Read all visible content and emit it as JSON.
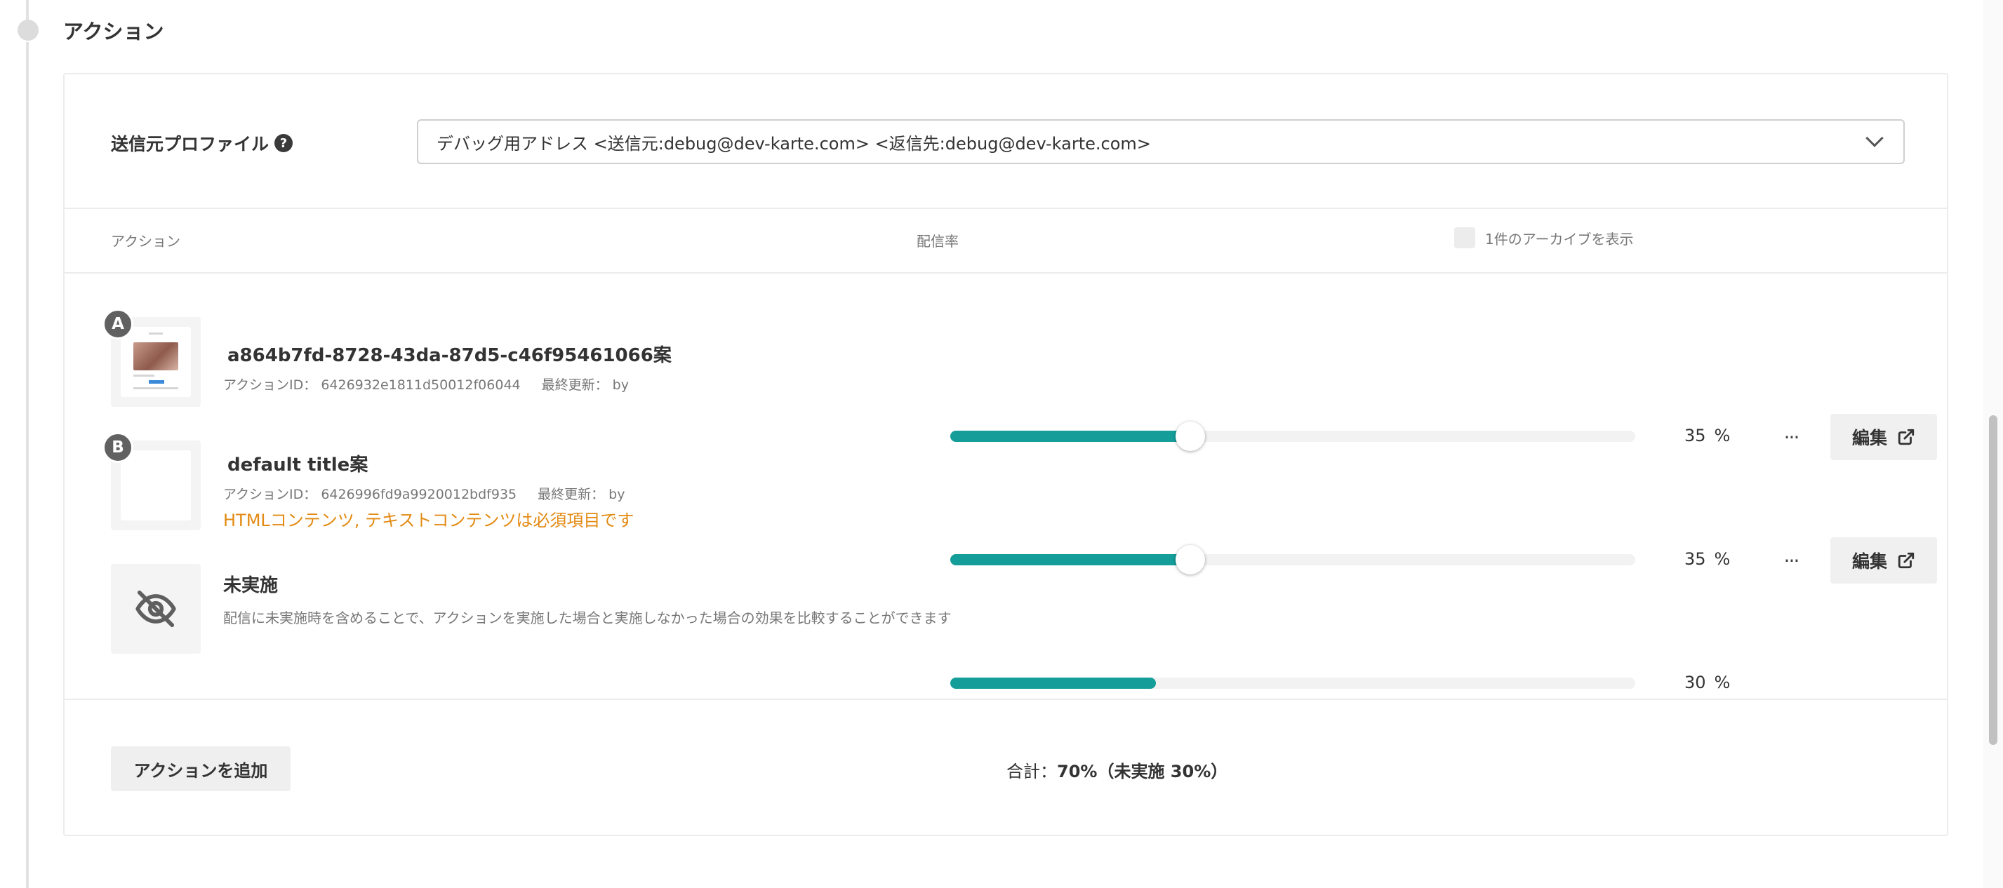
{
  "section": {
    "title": "アクション"
  },
  "profile": {
    "label": "送信元プロファイル",
    "help_icon": "?",
    "selected": "デバッグ用アドレス <送信元:debug@dev-karte.com> <返信先:debug@dev-karte.com>"
  },
  "table": {
    "col_action": "アクション",
    "col_rate": "配信率",
    "archive_label": "1件のアーカイブを表示"
  },
  "rows": [
    {
      "badge": "A",
      "title": "a864b7fd-8728-43da-87d5-c46f95461066案",
      "meta_id": "アクションID： 6426932e1811d50012f06044",
      "meta_updated": "最終更新： by",
      "rate": 35,
      "rate_text": "35",
      "unit": "%",
      "more": "···",
      "edit_label": "編集"
    },
    {
      "badge": "B",
      "title": "default title案",
      "meta_id": "アクションID： 6426996fd9a9920012bdf935",
      "meta_updated": "最終更新： by",
      "error": "HTMLコンテンツ, テキストコンテンツは必須項目です",
      "rate": 35,
      "rate_text": "35",
      "unit": "%",
      "more": "···",
      "edit_label": "編集"
    },
    {
      "title": "未実施",
      "description": "配信に未実施時を含めることで、アクションを実施した場合と実施しなかった場合の効果を比較することができます",
      "rate": 30,
      "rate_text": "30",
      "unit": "%"
    }
  ],
  "footer": {
    "add_button": "アクションを追加",
    "total_prefix": "合計：",
    "total_value": "70%（未実施 30%）"
  },
  "colors": {
    "accent": "#149d99",
    "error": "#e38a12",
    "badge": "#616161"
  },
  "icons": {
    "help": "question-circle-icon",
    "dropdown": "chevron-down-icon",
    "more": "ellipsis-icon",
    "external": "external-link-icon",
    "hidden": "eye-slash-icon"
  }
}
